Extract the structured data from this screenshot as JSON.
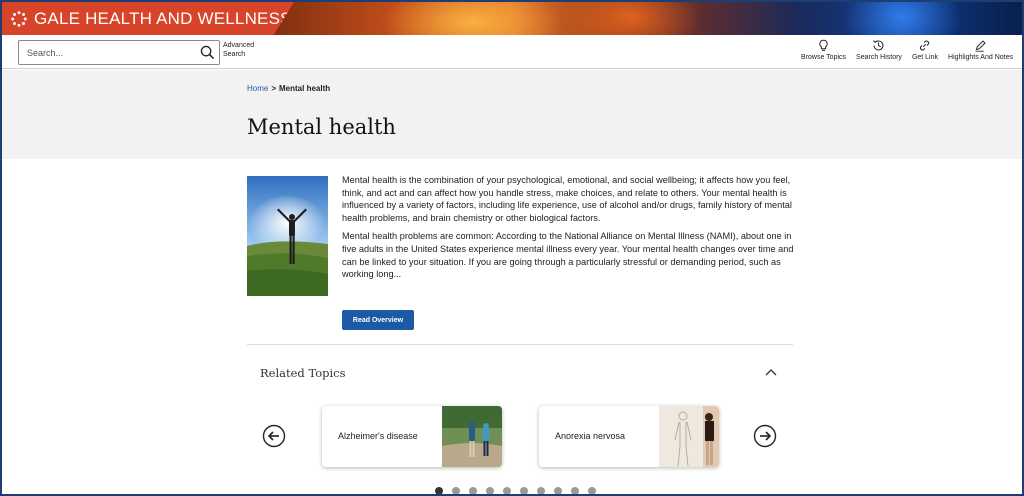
{
  "brand": {
    "title": "GALE HEALTH AND WELLNESS",
    "logo_icon": "gale-logo-icon",
    "accent": "#d8442a"
  },
  "search": {
    "placeholder": "Search...",
    "button_icon": "search-icon",
    "advanced_label": "Advanced Search"
  },
  "tools": [
    {
      "label": "Browse Topics",
      "icon": "lightbulb-icon"
    },
    {
      "label": "Search History",
      "icon": "history-icon"
    },
    {
      "label": "Get Link",
      "icon": "link-icon"
    },
    {
      "label": "Highlights And Notes",
      "icon": "pencil-icon"
    }
  ],
  "breadcrumb": {
    "home": "Home",
    "separator": ">",
    "current": "Mental health"
  },
  "page": {
    "title": "Mental health"
  },
  "overview": {
    "paragraphs": [
      "Mental health is the combination of your psychological, emotional, and social wellbeing; it affects how you feel, think, and act and can affect how you handle stress, make choices, and relate to others. Your mental health is influenced by a variety of factors, including life experience, use of alcohol and/or drugs, family history of mental health problems, and brain chemistry or other biological factors.",
      "Mental health problems are common: According to the National Alliance on Mental Illness (NAMI), about one in five adults in the United States experience mental illness every year. Your mental health changes over time and can be linked to your situation. If you are going through a particularly stressful or demanding period, such as working long..."
    ],
    "button_label": "Read Overview",
    "button_color": "#1d5aa6"
  },
  "related": {
    "title": "Related Topics",
    "collapse_icon": "chevron-up-icon",
    "prev_icon": "arrow-left-circle-icon",
    "next_icon": "arrow-right-circle-icon",
    "cards": [
      {
        "label": "Alzheimer's disease"
      },
      {
        "label": "Anorexia nervosa"
      }
    ],
    "page_count": 10,
    "active_page": 1
  }
}
